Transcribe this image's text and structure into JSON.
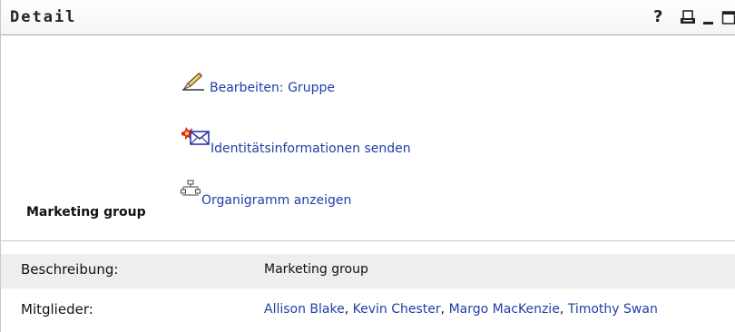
{
  "portlet": {
    "title": "Detail",
    "help_symbol": "?"
  },
  "actions": [
    {
      "label": "Bearbeiten: Gruppe",
      "icon": "pencil-icon"
    },
    {
      "label": "Identitätsinformationen senden",
      "icon": "envelope-icon"
    },
    {
      "label": "Organigramm anzeigen",
      "icon": "org-chart-icon"
    }
  ],
  "group": {
    "name": "Marketing group"
  },
  "fields": {
    "description_label": "Beschreibung:",
    "description_value": "Marketing group",
    "members_label": "Mitglieder:",
    "members": [
      "Allison Blake",
      "Kevin Chester",
      "Margo MacKenzie",
      "Timothy Swan"
    ],
    "separator": ", "
  },
  "colors": {
    "link": "#1f3fa6",
    "row_shade": "#eeeeee",
    "divider": "#c8c8c8"
  }
}
